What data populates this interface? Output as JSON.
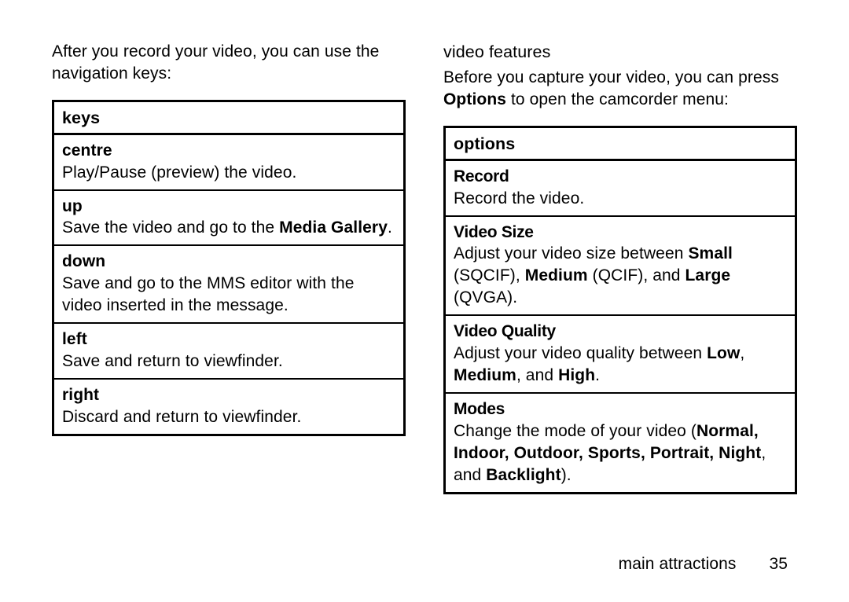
{
  "left": {
    "intro": "After you record your video, you can use the navigation keys:",
    "th": "keys",
    "rows": {
      "centre": {
        "k": "centre",
        "d": "Play/Pause (preview) the video."
      },
      "up": {
        "k": "up",
        "d_pre": "Save the video and go to the ",
        "bold": "Media Gallery",
        "d_post": "."
      },
      "down": {
        "k": "down",
        "d": "Save and go to the MMS editor with the video inserted in the message."
      },
      "left": {
        "k": "left",
        "d": "Save and return to viewfinder."
      },
      "right": {
        "k": "right",
        "d": "Discard and return to viewfinder."
      }
    }
  },
  "right": {
    "title": "video features",
    "intro_pre": "Before you capture your video, you can press ",
    "intro_bold": "Options",
    "intro_post": " to open the camcorder menu:",
    "th": "options",
    "rows": {
      "record": {
        "name": "Record",
        "d": "Record the video."
      },
      "size": {
        "name": "Video Size",
        "pre": "Adjust your video size between ",
        "b1": "Small",
        "t1": " (SQCIF), ",
        "b2": "Medium",
        "t2": " (QCIF), and ",
        "b3": "Large",
        "t3": " (QVGA)."
      },
      "quality": {
        "name": "Video Quality",
        "pre": "Adjust your video quality between ",
        "b1": "Low",
        "t1": ", ",
        "b2": "Medium",
        "t2": ", and ",
        "b3": "High",
        "t3": "."
      },
      "modes": {
        "name": "Modes",
        "pre": "Change the mode of your video (",
        "list": "Normal, Indoor, Outdoor, Sports, Portrait, Night",
        "t1": ", and ",
        "b2": "Backlight",
        "t2": ")."
      }
    }
  },
  "footer": {
    "chapter": "main attractions",
    "page": "35"
  }
}
